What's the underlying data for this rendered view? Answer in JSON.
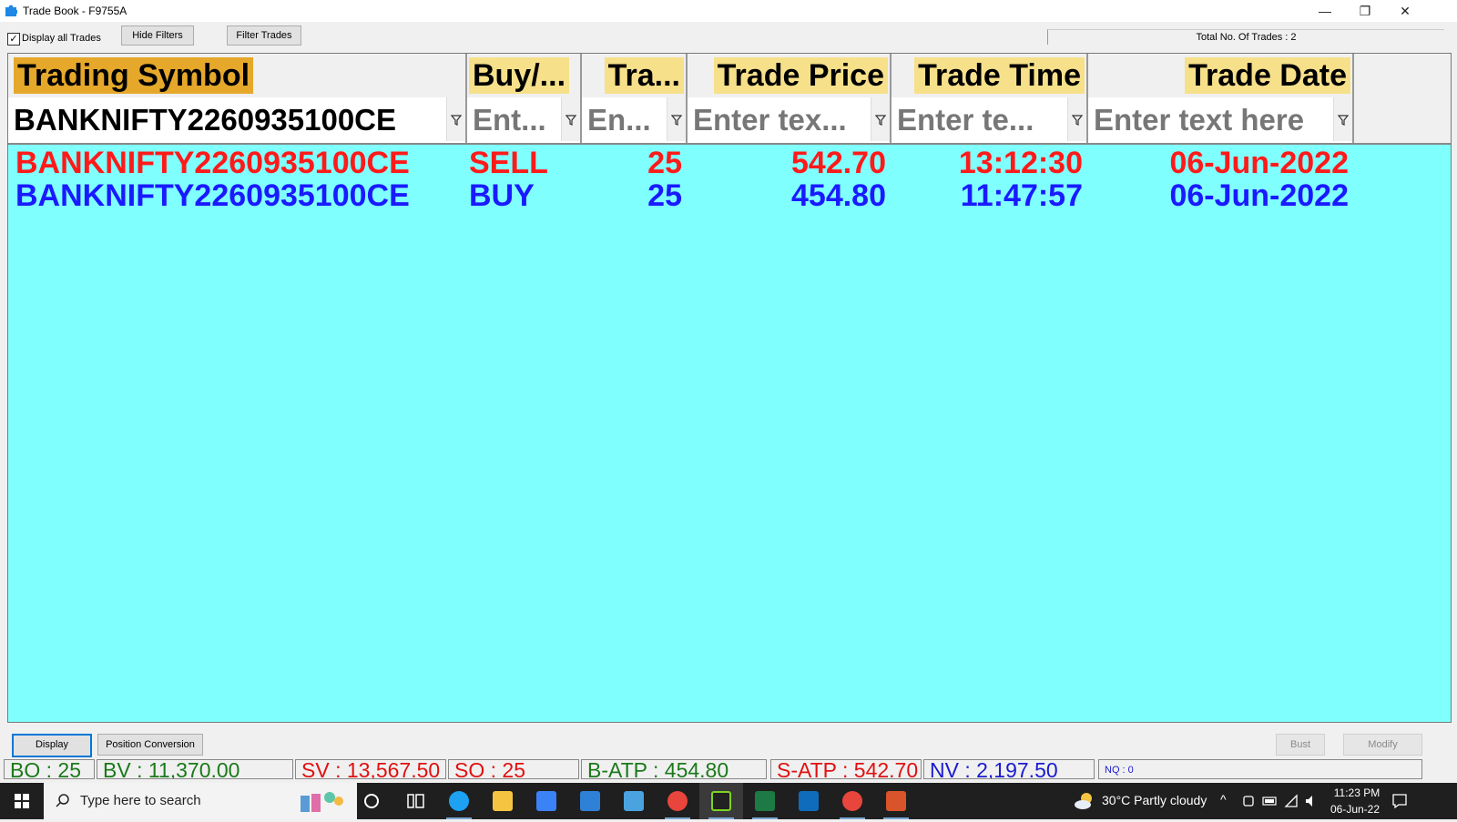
{
  "window": {
    "title": "Trade Book - F9755A",
    "minimize": "—",
    "restore": "❐",
    "close": "✕"
  },
  "toolbar": {
    "display_all_checked": "✓",
    "display_all_label": "Display all Trades",
    "hide_filters": "Hide Filters",
    "filter_trades": "Filter Trades",
    "total_trades": "Total No. Of Trades : 2"
  },
  "columns": [
    {
      "label": "Trading Symbol"
    },
    {
      "label": "Buy/..."
    },
    {
      "label": "Tra..."
    },
    {
      "label": "Trade Price"
    },
    {
      "label": "Trade Time"
    },
    {
      "label": "Trade Date"
    }
  ],
  "filters": [
    {
      "value": "BANKNIFTY2260935100CE",
      "active": true
    },
    {
      "value": "Ent...",
      "active": false
    },
    {
      "value": "En...",
      "active": false
    },
    {
      "value": "Enter tex...",
      "active": false
    },
    {
      "value": "Enter te...",
      "active": false
    },
    {
      "value": "Enter text here",
      "active": false
    }
  ],
  "rows": [
    {
      "symbol": "BANKNIFTY2260935100CE",
      "side": "SELL",
      "qty": "25",
      "price": "542.70",
      "time": "13:12:30",
      "date": "06-Jun-2022",
      "color": "#ff1a1a"
    },
    {
      "symbol": "BANKNIFTY2260935100CE",
      "side": "BUY",
      "qty": "25",
      "price": "454.80",
      "time": "11:47:57",
      "date": "06-Jun-2022",
      "color": "#1a1aff"
    }
  ],
  "bottom_buttons": {
    "display": "Display",
    "position_conversion": "Position Conversion",
    "bust": "Bust",
    "modify": "Modify"
  },
  "status": {
    "bo": "BO : 25",
    "bv": "BV : 11,370.00",
    "sv": "SV : 13,567.50",
    "so": "SO : 25",
    "batp": "B-ATP : 454.80",
    "satp": "S-ATP : 542.70",
    "nv": "NV : 2,197.50",
    "nq": "NQ : 0"
  },
  "taskbar": {
    "search_placeholder": "Type here to search",
    "weather": "30°C  Partly cloudy",
    "time": "11:23 PM",
    "date": "06-Jun-22"
  },
  "colors": {
    "grid_bg": "#80ffff",
    "header_label_bg": "#f7e08a",
    "active_header_bg": "#e5a82a",
    "sell": "#ff1a1a",
    "buy": "#1a1aff",
    "status_green": "#1a7a1a",
    "status_red": "#e01010",
    "status_blue": "#1a1ad0"
  }
}
